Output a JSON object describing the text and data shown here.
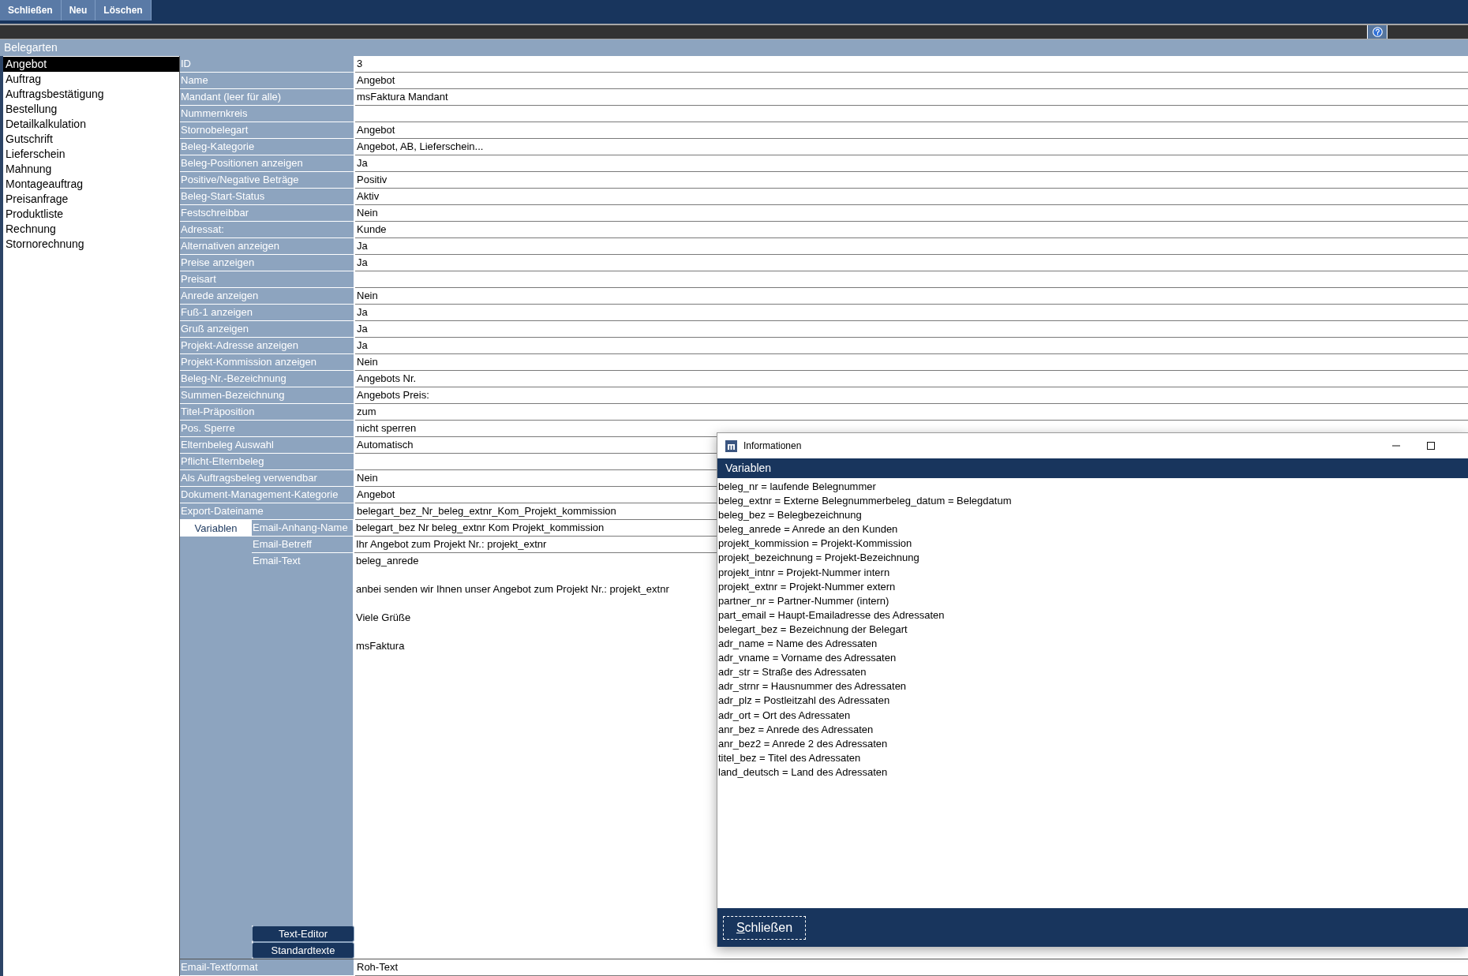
{
  "toolbar": {
    "buttons": [
      "Schließen",
      "Neu",
      "Löschen"
    ]
  },
  "sidebar": {
    "title": "Belegarten",
    "items": [
      {
        "label": "Angebot",
        "selected": true
      },
      {
        "label": "Auftrag",
        "selected": false
      },
      {
        "label": "Auftragsbestätigung",
        "selected": false
      },
      {
        "label": "Bestellung",
        "selected": false
      },
      {
        "label": "Detailkalkulation",
        "selected": false
      },
      {
        "label": "Gutschrift",
        "selected": false
      },
      {
        "label": "Lieferschein",
        "selected": false
      },
      {
        "label": "Mahnung",
        "selected": false
      },
      {
        "label": "Montageauftrag",
        "selected": false
      },
      {
        "label": "Preisanfrage",
        "selected": false
      },
      {
        "label": "Produktliste",
        "selected": false
      },
      {
        "label": "Rechnung",
        "selected": false
      },
      {
        "label": "Stornorechnung",
        "selected": false
      }
    ]
  },
  "fields": [
    {
      "label": "ID",
      "value": "3"
    },
    {
      "label": "Name",
      "value": "Angebot"
    },
    {
      "label": "Mandant (leer für alle)",
      "value": "msFaktura Mandant"
    },
    {
      "label": "Nummernkreis"
    },
    {
      "label": "Stornobelegart",
      "value": "Angebot"
    },
    {
      "label": "Beleg-Kategorie",
      "value": "Angebot, AB, Lieferschein..."
    },
    {
      "label": "Beleg-Positionen anzeigen",
      "value": "Ja"
    },
    {
      "label": "Positive/Negative Beträge",
      "value": "Positiv"
    },
    {
      "label": "Beleg-Start-Status",
      "value": "Aktiv"
    },
    {
      "label": "Festschreibbar",
      "value": "Nein"
    },
    {
      "label": "Adressat:",
      "value": "Kunde"
    },
    {
      "label": "Alternativen anzeigen",
      "value": "Ja"
    },
    {
      "label": "Preise anzeigen",
      "value": "Ja"
    },
    {
      "label": "Preisart"
    },
    {
      "label": "Anrede anzeigen",
      "value": "Nein"
    },
    {
      "label": "Fuß-1 anzeigen",
      "value": "Ja"
    },
    {
      "label": "Gruß anzeigen",
      "value": "Ja"
    },
    {
      "label": "Projekt-Adresse anzeigen",
      "value": "Ja"
    },
    {
      "label": "Projekt-Kommission anzeigen",
      "value": "Nein"
    },
    {
      "label": "Beleg-Nr.-Bezeichnung",
      "value": "Angebots Nr."
    },
    {
      "label": "Summen-Bezeichnung",
      "value": "Angebots Preis:"
    },
    {
      "label": "Titel-Präposition",
      "value": "zum"
    },
    {
      "label": "Pos. Sperre",
      "value": "nicht sperren"
    },
    {
      "label": "Elternbeleg Auswahl",
      "value": "Automatisch"
    },
    {
      "label": "Pflicht-Elternbeleg"
    },
    {
      "label": "Als Auftragsbeleg verwendbar",
      "value": "Nein"
    },
    {
      "label": "Dokument-Management-Kategorie",
      "value": "Angebot"
    },
    {
      "label": "Export-Dateiname",
      "value": "belegart_bez_Nr_beleg_extnr_Kom_Projekt_kommission"
    }
  ],
  "email": {
    "tab": {
      "label": "Variablen",
      "selected": true
    },
    "fields": [
      {
        "label": "Email-Anhang-Name",
        "value": "belegart_bez Nr beleg_extnr Kom Projekt_kommission"
      },
      {
        "label": "Email-Betreff",
        "value": "Ihr Angebot zum Projekt Nr.: projekt_extnr"
      }
    ],
    "text": {
      "label": "Email-Text",
      "paragraphs": [
        "beleg_anrede",
        "anbei senden wir Ihnen unser Angebot zum Projekt Nr.: projekt_extnr",
        "Viele Grüße",
        "msFaktura"
      ]
    },
    "buttons": [
      "Text-Editor",
      "Standardtexte"
    ]
  },
  "footer_field": {
    "label": "Email-Textformat",
    "value": "Roh-Text"
  },
  "dialog": {
    "title": "Informationen",
    "heading": "Variablen",
    "lines": [
      "beleg_nr = laufende Belegnummer",
      "beleg_extnr = Externe Belegnummerbeleg_datum = Belegdatum",
      "beleg_bez = Belegbezeichnung",
      "beleg_anrede = Anrede an den Kunden",
      "projekt_kommission = Projekt-Kommission",
      "projekt_bezeichnung = Projekt-Bezeichnung",
      "projekt_intnr = Projekt-Nummer intern",
      "projekt_extnr = Projekt-Nummer extern",
      "partner_nr = Partner-Nummer (intern)",
      "part_email = Haupt-Emailadresse des Adressaten",
      "belegart_bez = Bezeichnung der Belegart",
      "adr_name = Name des Adressaten",
      "adr_vname = Vorname des Adressaten",
      "adr_str = Straße des Adressaten",
      "adr_strnr = Hausnummer des Adressaten",
      "adr_plz = Postleitzahl des Adressaten",
      "adr_ort = Ort des Adressaten",
      "anr_bez = Anrede des Adressaten",
      "anr_bez2 = Anrede 2 des Adressaten",
      "titel_bez = Titel des Adressaten",
      "land_deutsch = Land des Adressaten"
    ],
    "close_button": "Schließen"
  }
}
